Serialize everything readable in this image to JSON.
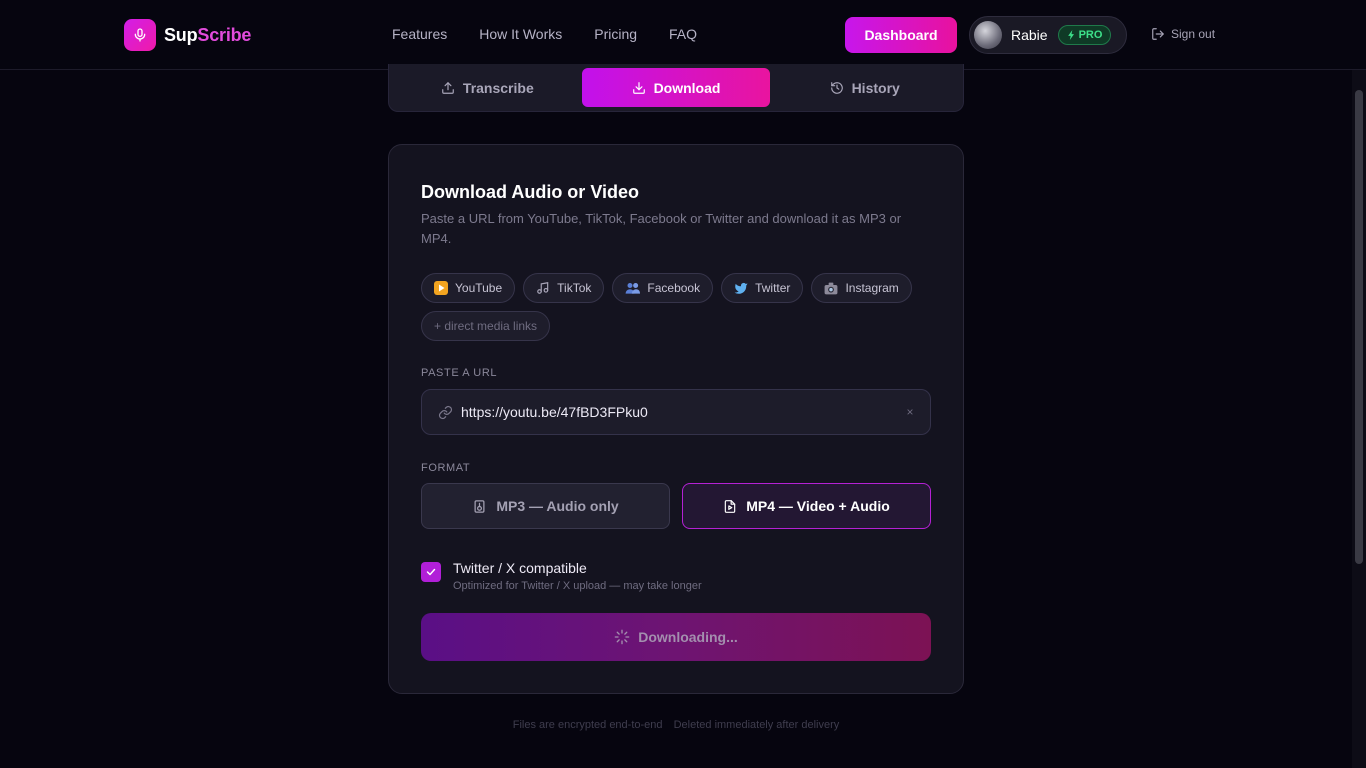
{
  "brand": {
    "name_part1": "Sup",
    "name_part2": "Scribe"
  },
  "nav": {
    "items": [
      "Features",
      "How It Works",
      "Pricing",
      "FAQ"
    ]
  },
  "header": {
    "dashboard_label": "Dashboard",
    "user_name": "Rabie",
    "plan_badge": "PRO",
    "signout_label": "Sign out"
  },
  "tabs": [
    {
      "label": "Transcribe",
      "active": false
    },
    {
      "label": "Download",
      "active": true
    },
    {
      "label": "History",
      "active": false
    }
  ],
  "card": {
    "title": "Download Audio or Video",
    "subtitle": "Paste a URL from YouTube, TikTok, Facebook or Twitter and download it as MP3 or MP4.",
    "platforms": [
      {
        "label": "YouTube",
        "icon": "play-icon"
      },
      {
        "label": "TikTok",
        "icon": "music-note-icon"
      },
      {
        "label": "Facebook",
        "icon": "people-icon"
      },
      {
        "label": "Twitter",
        "icon": "bird-icon"
      },
      {
        "label": "Instagram",
        "icon": "camera-icon"
      }
    ],
    "direct_links_label": "+ direct media links",
    "url_section_label": "PASTE A URL",
    "url_value": "https://youtu.be/47fBD3FPku0",
    "url_clear": "×",
    "format_section_label": "FORMAT",
    "format_mp3": "MP3 — Audio only",
    "format_mp4": "MP4 — Video + Audio",
    "selected_format": "MP4",
    "twitter_compat": {
      "checked": true,
      "title": "Twitter / X compatible",
      "description": "Optimized for Twitter / X upload — may take longer"
    },
    "download_button": "Downloading..."
  },
  "footer": {
    "note1": "Files are encrypted end-to-end",
    "note2": "Deleted immediately after delivery"
  },
  "colors": {
    "accent": "#c716ec",
    "accent2": "#e8129e",
    "background": "#06050f",
    "card": "#14131f",
    "pro_green": "#3de08a"
  }
}
